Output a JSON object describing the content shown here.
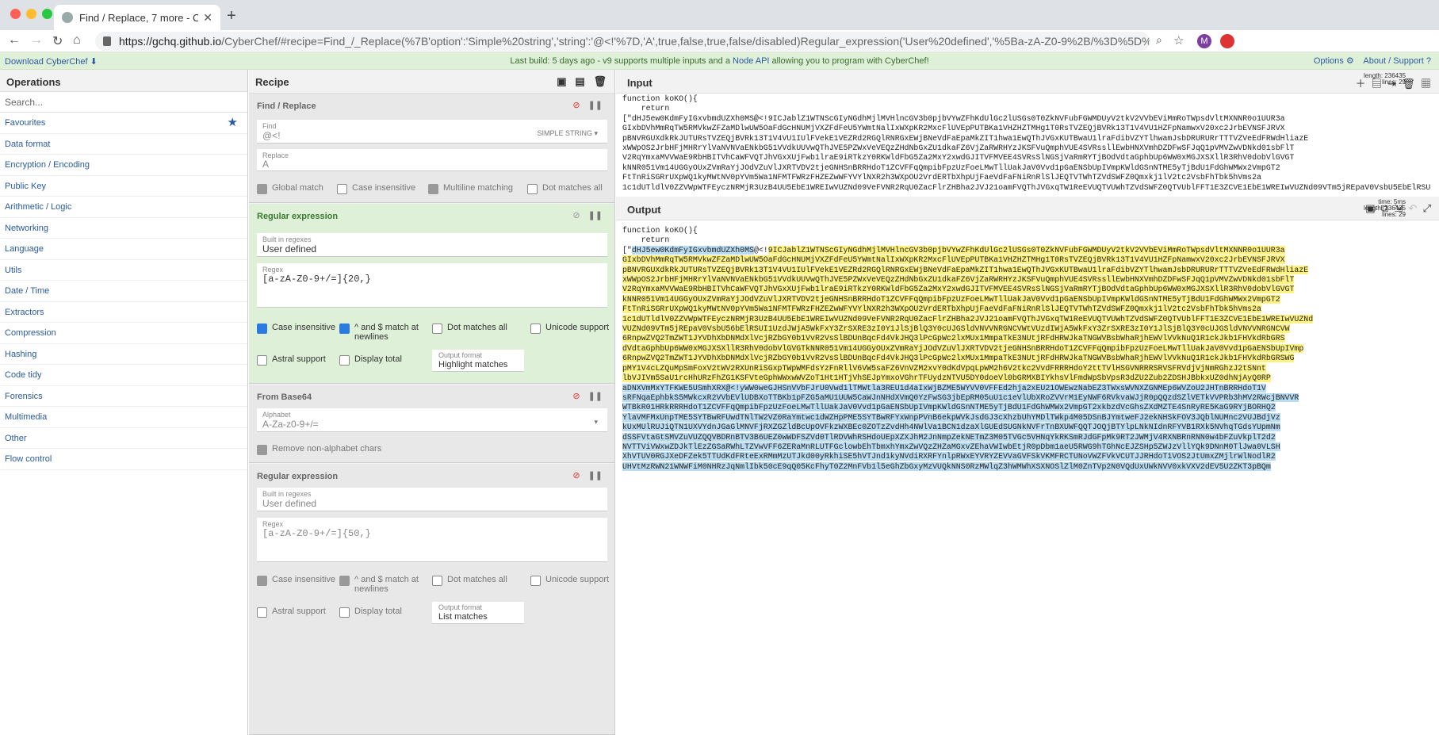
{
  "browser": {
    "tab_title": "Find / Replace, 7 more - Cyber",
    "url_host": "https://gchq.github.io",
    "url_path": "/CyberChef/#recipe=Find_/_Replace(%7B'option':'Simple%20string','string':'@<!'%7D,'A',true,false,true,false/disabled)Regular_expression('User%20defined','%5Ba-zA-Z0-9%2B/%3D%5D%7B20,%7D',tru...",
    "colors": {
      "close": "#ff5f57",
      "minimize": "#febc2e",
      "maximize": "#28c840",
      "accent": "#2a5aa0"
    }
  },
  "banner": {
    "download": "Download CyberChef",
    "notice_prefix": "Last build: 5 days ago - v9 supports multiple inputs and a ",
    "notice_link": "Node API",
    "notice_suffix": " allowing you to program with CyberChef!",
    "options": "Options",
    "about": "About / Support"
  },
  "operations": {
    "title": "Operations",
    "search_placeholder": "Search...",
    "categories": [
      "Favourites",
      "Data format",
      "Encryption / Encoding",
      "Public Key",
      "Arithmetic / Logic",
      "Networking",
      "Language",
      "Utils",
      "Date / Time",
      "Extractors",
      "Compression",
      "Hashing",
      "Code tidy",
      "Forensics",
      "Multimedia",
      "Other",
      "Flow control"
    ]
  },
  "recipe": {
    "title": "Recipe",
    "find_replace": {
      "title": "Find / Replace",
      "find_label": "Find",
      "find_value": "@<!",
      "find_type": "SIMPLE STRING ▾",
      "replace_label": "Replace",
      "replace_value": "A",
      "opts": [
        "Global match",
        "Case insensitive",
        "Multiline matching",
        "Dot matches all"
      ]
    },
    "regex1": {
      "title": "Regular expression",
      "builtin_label": "Built in regexes",
      "builtin_value": "User defined",
      "regex_label": "Regex",
      "regex_value": "[a-zA-Z0-9+/=]{20,}",
      "opts": [
        "Case insensitive",
        "^ and $ match at newlines",
        "Dot matches all",
        "Unicode support",
        "Astral support",
        "Display total"
      ],
      "outfmt_label": "Output format",
      "outfmt_value": "Highlight matches"
    },
    "base64": {
      "title": "From Base64",
      "alpha_label": "Alphabet",
      "alpha_value": "A-Za-z0-9+/=",
      "opt": "Remove non-alphabet chars"
    },
    "regex2": {
      "title": "Regular expression",
      "builtin_label": "Built in regexes",
      "builtin_value": "User defined",
      "regex_label": "Regex",
      "regex_value": "[a-zA-Z0-9+/=]{50,}",
      "opts": [
        "Case insensitive",
        "^ and $ match at newlines",
        "Dot matches all",
        "Unicode support",
        "Astral support",
        "Display total"
      ],
      "outfmt_label": "Output format",
      "outfmt_value": "List matches"
    }
  },
  "input": {
    "title": "Input",
    "length_label": "length:",
    "length": "236435",
    "lines_label": "lines:",
    "lines": "29",
    "text": [
      "function koKO(){",
      "    return",
      "[\"dHJ5ew0KdmFyIGxvbmdUZXh0MS@<!9ICJablZ1WTNScGIyNGdhMjlMVHlncGV3b0pjbVYwZFhKdUlGc2lUSGs0T0ZkNVFubFGWMDUyV2tkV2VVbEViMmRoTWpsdVltMXNNR0o1UUR3a",
      "GIxbDVhMmRqTW5RMVkwZFZaMDlwUW5OaFdGcHNUMjVXZFdFeU5YWmtNalIxWXpKR2MxcFlUVEpPUTBKa1VHZHZTMHg1T0RsTVZEQjBVRk13T1V4VU1HZFpNamwxV20xc2JrbEVNSFJRVX",
      "pBNVRGUXdkRkJUTURsTVZEQjBVRk13T1V4VU1IUlFVekE1VEZRd2RGQlRNRGxEWjBNeVdFaEpaMkZIT1hwa1EwQThJVGxKUTBwaU1lraFdibVZYTlhwamJsbDRURURrTTTVZVeEdFRWdHliazE",
      "xWWpOS2JrbHFjMHRrYlVaNVNVaENkbG51VVdkUUVwQThJVE5PZWxVeVEQzZHdNbGxZU1dkaFZ6VjZaRWRHYzJKSFVuQmphVUE4SVRssllEwbHNXVmhDZDFwSFJqQ1pVMVZwVDNkd01sbFlT",
      "V2RqYmxaMVVWaE9RbHBITVhCaWFVQTJhVGxXUjFwb1lraE9iRTkzY0RKWldFbG5Za2MxY2xwdGJITVFMVEE4SVRsSlNGSjVaRmRYTjBOdVdtaGphbUp6WW0xMGJXSXllR3RhV0dobVlGVGT",
      "kNNR051Vm14UGGyOUxZVmRaYjJOdVZuVlJXRTVDV2tjeGNHSnBRRHdoT1ZCVFFqQmpibFpzUzFoeLMwTllUakJaV0Vvd1pGaENSbUpIVmpKWldGSnNTME5yTjBdU1FdGhWMWx2VmpGT2",
      "FtTnRiSGRrUXpWQ1kyMWtNV0pYVm5Wa1NFMTFWRzFHZEZwWFYVYlNXR2h3WXpOU2VrdERTbXhpUjFaeVdFaFNiRnRlSlJEQTVTWhTZVdSWFZ0Qmxkj1lV2tc2VsbFhTbk5hVms2a",
      "1c1dUTldlV0ZZVWpWTFEyczNRMjR3UzB4UU5EbE1WREIwVUZNd09VeFVNR2RqU0ZacFlrZHBha2JVJ21oamFVQThJVGxqTW1ReEVUQTVUWhTZVdSWFZ0QTVUblFFT1E3ZCVE1EbE1WREIwVUZNd09VTm5jREpaV0VsbU5EbElRSUI1UzdJWjA5WkFxY3ZrSXRE3zI0Y1JlSjBlQ3Y0cUJGS"
    ]
  },
  "output": {
    "title": "Output",
    "time_label": "time:",
    "time": "5ms",
    "length_label": "length:",
    "length": "236435",
    "lines_label": "lines:",
    "lines": "29",
    "line1": "function koKO(){",
    "line2": "    return",
    "line3_prefix": "[\"",
    "line3_hl": "dHJ5ew0KdmFyIGxvbmdUZXh0MS",
    "line3_mid": "@<!",
    "line3_rest": "9ICJablZ1WTNScGIyNGdhMjlMVHlncGV3b0pjbVYwZFhKdUlGc2lUSGs0T0ZkNVFubFGWMDUyV2tkV2VVbEViMmRoTWpsdVltMXNNR0o1UUR3a",
    "body": [
      "GIxbDVhMmRqTW5RMVkwZFZaMDlwUW5OaFdGcHNUMjVXZFdFeU5YWmtNalIxWXpKR2MxcFlUVEpPUTBKa1VHZHZTMHg1T0RsTVZEQjBVRk13T1V4VU1HZFpNamwxV20xc2JrbEVNSFJRVX",
      "pBNVRGUXdkRkJUTURsTVZEQjBVRk13T1V4VU1IUlFVekE1VEZRd2RGQlRNRGxEWjBNeVdFaEpaMkZIT1hwa1EwQThJVGxKUTBwaU1lraFdibVZYTlhwamJsbDRURURrTTTVZVeEdFRWdHliazE",
      "xWWpOS2JrbHFjMHRrYlVaNVNVaENkbG51VVdkUUVwQThJVE5PZWxVeVEQzZHdNbGxZU1dkaFZ6VjZaRWRHYzJKSFVuQmphVUE4SVRssllEwbHNXVmhDZDFwSFJqQ1pVMVZwVDNkd01sbFlT",
      "V2RqYmxaMVVWaE9RbHBITVhCaWFVQTJhVGxXUjFwb1lraE9iRTkzY0RKWldFbG5Za2MxY2xwdGJITVFMVEE4SVRsSlNGSjVaRmRYTjBOdVdtaGphbUp6WW0xMGJXSXllR3RhV0dobVlGVGT",
      "kNNR051Vm14UGGyOUxZVmRaYjJOdVZuVlJXRTVDV2tjeGNHSnBRRHdoT1ZCVFFqQmpibFpzUzFoeLMwTllUakJaV0Vvd1pGaENSbUpIVmpKWldGSnNTME5yTjBdU1FdGhWMWx2VmpGT2",
      "FtTnRiSGRrUXpWQ1kyMWtNV0pYVm5Wa1NFMTFWRzFHZEZwWFYVYlNXR2h3WXpOU2VrdERTbXhpUjFaeVdFaFNiRnRlSlJEQTVTWhTZVdSWFZ0Qmxkj1lV2tc2VsbFhTbk5hVms2a",
      "1c1dUTldlV0ZZVWpWTFEyczNRMjR3UzB4UU5EbE1WREIwVUZNd09VeFVNR2RqU0ZacFlrZHBha2JVJ21oamFVQThJVGxqTW1ReEVUQTVUWhTZVdSWFZ0QTVUblFFT1E3ZCVE1EbE1WREIwVUZNd",
      "VUZNd09VTm5jREpaV0VsbU56bElRSUI1UzdJWjA5WkFxY3ZrSXRE3zI0Y1JlSjBlQ3Y0cUJGSldVNVVNRGNCVWtVUzdIWjA5WkFxY3ZrSXRE3zI0Y1JlSjBlQ3Y0cUJGSldVNVVNRGNCVW",
      "6RnpwZVQ2TmZWT1JYVDhXbDNMdXlVcjRZbGY0b1VvR2VsSlBDUnBqcFd4VkJHQ3lPcGpWc2lxMUx1MmpaTkE3NUtjRFdHRWJkaTNGWVBsbWhaRjhEWVlVVkNuQ1R1ckJkb1FHVkdRbGRS",
      "dVdtaGphbUp6WW0xMGJXSXllR3RhV0dobVlGVGTkNNR051Vm14UGGyOUxZVmRaYjJOdVZuVlJXRTVDV2tjeGNHSnBRRHdoT1ZCVFFqQmpibFpzUzFoeLMwTllUakJaV0Vvd1pGaENSbUpIVmp",
      "6RnpwZVQ2TmZWT1JYVDhXbDNMdXlVcjRZbGY0b1VvR2VsSlBDUnBqcFd4VkJHQ3lPcGpWc2lxMUx1MmpaTkE3NUtjRFdHRWJkaTNGWVBsbWhaRjhEWVlVVkNuQ1R1ckJkb1FHVkdRbGRSWG",
      "pMY1V4cLZQuMpSmFoxV2tWV2RXUnRiSGxpTWpWMFdsYzFnRllV6VW5saFZ6VnVZM2xvY0dKdVpqLpWM2h6V2tkc2VvdFRRRHdoY2ttTVlHSGVNRRRSRVSFRVdjVjNmRGhzJ2tSNnt",
      "lbVJIVm5SaU1rcHhURzFhZG1KSFVteGphWWxwWVZoT1Ht1HTjVhSEJpYmxoVGhrTFUydzNTVU5DY0doeVl0bGRMXBIYkhsVlFmdWpSbVpsR3dZU2Zub2ZDSHJBbkxUZ0dhNjAyQ0RP",
      "aDNXVmMxYTFKWE5USmhXRX@<!yWW0weGJHSnVVbFJrU0Vwd1lTMWtla3REU1d4aIxWjBZME5WYVV0VFFEd2hja2xEU21OWEwzNabEZ3TWxsWVNXZGNMEp6WVZoU2JHTnBRRHdoT1V",
      "sRFNqaEphbkS5MWkcxR2VVbEVlUDBXoTTBKb1pFZG5aMU1UUW5CaWJnNHdXVmQ0YzFwSG3jbEpRM05uU1c1eVlUbXRoZVVrM1EyNWF6RVkvaWJjR0pQQzdSZlVETkVVPRb3hMV2RWcjBNVVR",
      "WTBkR01HRkRRRHdoT1ZCVFFqQmpibFpzUzFoeLMwTllUakJaV0Vvd1pGaENSbUpIVmpKWldGSnNTME5yTjBdU1FdGhWMWx2VmpGT2xkbzdVcGhsZXdMZTE4SnRyRE5KaG9RYjBORHQ2",
      "YlaVMFMxUnpTME5SYTBwRFUwdTNlTW2VZ0RaYmtwc1dWZHpPME5SYTBwRFYxWnpPVnB6ekpWVkJsdGJ3cXhzbUhYMDlTWkp4M05DSnBJYmtweFJ2ekNHSkFOV3JQblNUMnc2VUJBdjVz",
      "kUxMUlRUJiQTN1UXVYdnJGaGlMNVFjRXZGZldBcUpOVFkzWXBEc0ZOTzZvdHh4NWlVa1BCN1dzaXlGUEdSUGNkNVFrTnBXUWFQQTJOQjBTYlpLNkNIdnRFYVB1RXk5NVhqTGdsYUpmNm",
      "dSSFVtaGtSMVZuVUZQQVBDRnBTV3B6UEZ0wWDFSZVd0TlRDVWhRSHdoUEpXZXJhM2JnNmpZekNETmZ3M05TVGc5VHNqYkRKSmRJdGFpMk9RT2JWMjV4RXNBRnRNN0w4bFZuVkplT2d2",
      "NVTTViVWxwZDJkTlEzZGSaRWhLTZVwVFF6ZERaMnRLUTFGclowbEhTbmxhYmxZwVQzZHZaMGxvZEhaVWIwbEtjR0pDbm1aeU5RWG9hTGhNcEJZSHp5ZWJzVllYQk9DNnM0TlJwa0VLSH",
      "XhVTUV0RGJXeDFZek5TTUdKdFRteExRMmMzUTJkd00yRkhiSE5hVTJnd1kyNVdiRXRFYnlpRWxEYVRYZEVVaGVFSkVKMFRCTUNoVWZFVkVCUTJJRHdoT1VOS2JtUmxZMjlrWlNodlR2",
      "UHVtMzRWN21WNWFiM0NHRzJqNmlIbk50cE9qQ05KcFhyT0Z2MnFVb1l5eGhZbGxyMzVUQkNNS0RzMWlqZ3hWMWhXSXNOSlZlM0ZnTVp2N0VQdUxUWkNVV0xkVXV2dEV5U2ZKT3pBQm"
    ]
  }
}
